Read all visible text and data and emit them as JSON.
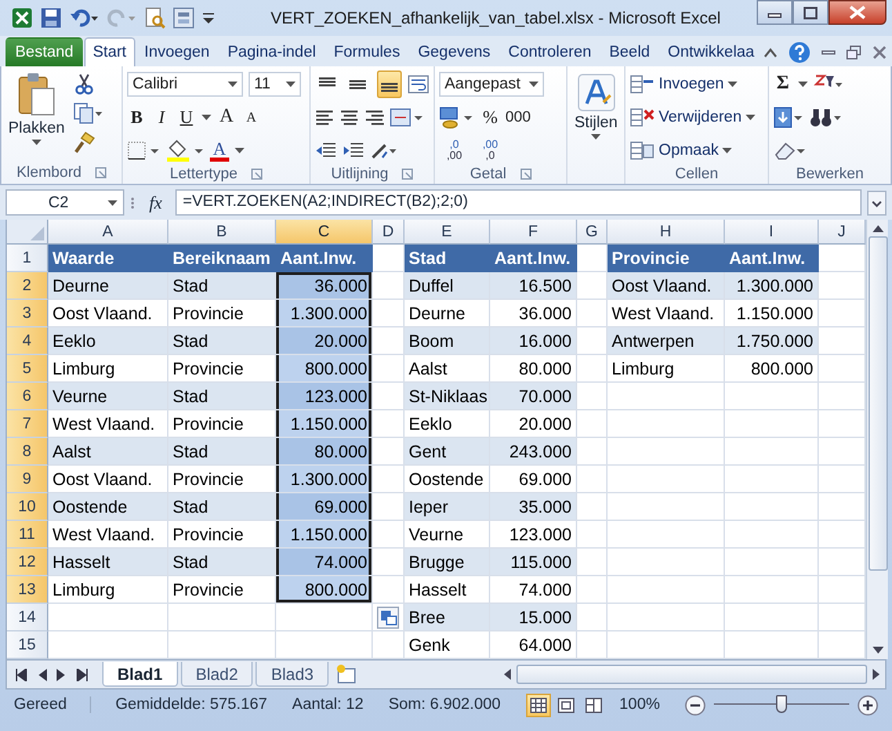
{
  "window": {
    "title": "VERT_ZOEKEN_afhankelijk_van_tabel.xlsx - Microsoft Excel"
  },
  "ribbon_tabs": [
    {
      "label": "Bestand",
      "kind": "file",
      "selected": false
    },
    {
      "label": "Start",
      "kind": "tab",
      "selected": true
    },
    {
      "label": "Invoegen",
      "kind": "tab",
      "selected": false
    },
    {
      "label": "Pagina-indel",
      "kind": "tab",
      "selected": false
    },
    {
      "label": "Formules",
      "kind": "tab",
      "selected": false
    },
    {
      "label": "Gegevens",
      "kind": "tab",
      "selected": false
    },
    {
      "label": "Controleren",
      "kind": "tab",
      "selected": false
    },
    {
      "label": "Beeld",
      "kind": "tab",
      "selected": false
    },
    {
      "label": "Ontwikkelaa",
      "kind": "tab",
      "selected": false
    }
  ],
  "ribbon": {
    "clipboard": {
      "paste": "Plakken",
      "group_label": "Klembord"
    },
    "font": {
      "name": "Calibri",
      "size": "11",
      "styles": [
        "B",
        "I",
        "U"
      ],
      "grow": "A",
      "shrink": "A",
      "color_letter": "A",
      "group_label": "Lettertype"
    },
    "alignment": {
      "vertical": [
        {
          "selected": false
        },
        {
          "selected": false
        },
        {
          "selected": true
        }
      ],
      "group_label": "Uitlijning"
    },
    "number": {
      "format": "Aangepast",
      "percent": "%",
      "thousands": "000",
      "decimals": [
        {
          "top": ",0",
          "bottom": ",00"
        },
        {
          "top": ",00",
          "bottom": ",0"
        }
      ],
      "group_label": "Getal"
    },
    "styles": {
      "label": "Stijlen"
    },
    "cells": {
      "items": [
        "Invoegen",
        "Verwijderen",
        "Opmaak"
      ],
      "group_label": "Cellen"
    },
    "editing": {
      "sum": "Σ",
      "group_label": "Bewerken"
    }
  },
  "formula_bar": {
    "name_box": "C2",
    "fx": "fx",
    "formula": "=VERT.ZOEKEN(A2;INDIRECT(B2);2;0)"
  },
  "sheet": {
    "columns": [
      {
        "label": "A",
        "selected": false
      },
      {
        "label": "B",
        "selected": false
      },
      {
        "label": "C",
        "selected": true
      },
      {
        "label": "D",
        "selected": false
      },
      {
        "label": "E",
        "selected": false
      },
      {
        "label": "F",
        "selected": false
      },
      {
        "label": "G",
        "selected": false
      },
      {
        "label": "H",
        "selected": false
      },
      {
        "label": "I",
        "selected": false
      },
      {
        "label": "J",
        "selected": false
      }
    ],
    "rows": [
      {
        "label": "1",
        "selected": false,
        "cells": [
          {
            "text": "Waarde",
            "kind": "heading",
            "selected": false
          },
          {
            "text": "Bereiknaam",
            "kind": "heading",
            "selected": false
          },
          {
            "text": "Aant.Inw.",
            "kind": "heading",
            "selected": false
          },
          null,
          {
            "text": "Stad",
            "kind": "heading",
            "selected": false
          },
          {
            "text": "Aant.Inw.",
            "kind": "heading",
            "selected": false
          },
          null,
          {
            "text": "Provincie",
            "kind": "heading",
            "selected": false
          },
          {
            "text": "Aant.Inw.",
            "kind": "heading",
            "selected": false
          },
          null
        ]
      },
      {
        "label": "2",
        "selected": true,
        "cells": [
          {
            "text": "Deurne",
            "kind": "text",
            "selected": false
          },
          {
            "text": "Stad",
            "kind": "text",
            "selected": false
          },
          {
            "text": "36.000",
            "kind": "number",
            "selected": true
          },
          null,
          {
            "text": "Duffel",
            "kind": "text",
            "selected": false
          },
          {
            "text": "16.500",
            "kind": "number",
            "selected": false
          },
          null,
          {
            "text": "Oost Vlaand.",
            "kind": "text",
            "selected": false
          },
          {
            "text": "1.300.000",
            "kind": "number",
            "selected": false
          },
          null
        ]
      },
      {
        "label": "3",
        "selected": true,
        "cells": [
          {
            "text": "Oost Vlaand.",
            "kind": "text",
            "selected": false
          },
          {
            "text": "Provincie",
            "kind": "text",
            "selected": false
          },
          {
            "text": "1.300.000",
            "kind": "number",
            "selected": true
          },
          null,
          {
            "text": "Deurne",
            "kind": "text",
            "selected": false
          },
          {
            "text": "36.000",
            "kind": "number",
            "selected": false
          },
          null,
          {
            "text": "West Vlaand.",
            "kind": "text",
            "selected": false
          },
          {
            "text": "1.150.000",
            "kind": "number",
            "selected": false
          },
          null
        ]
      },
      {
        "label": "4",
        "selected": true,
        "cells": [
          {
            "text": "Eeklo",
            "kind": "text",
            "selected": false
          },
          {
            "text": "Stad",
            "kind": "text",
            "selected": false
          },
          {
            "text": "20.000",
            "kind": "number",
            "selected": true
          },
          null,
          {
            "text": "Boom",
            "kind": "text",
            "selected": false
          },
          {
            "text": "16.000",
            "kind": "number",
            "selected": false
          },
          null,
          {
            "text": "Antwerpen",
            "kind": "text",
            "selected": false
          },
          {
            "text": "1.750.000",
            "kind": "number",
            "selected": false
          },
          null
        ]
      },
      {
        "label": "5",
        "selected": true,
        "cells": [
          {
            "text": "Limburg",
            "kind": "text",
            "selected": false
          },
          {
            "text": "Provincie",
            "kind": "text",
            "selected": false
          },
          {
            "text": "800.000",
            "kind": "number",
            "selected": true
          },
          null,
          {
            "text": "Aalst",
            "kind": "text",
            "selected": false
          },
          {
            "text": "80.000",
            "kind": "number",
            "selected": false
          },
          null,
          {
            "text": "Limburg",
            "kind": "text",
            "selected": false
          },
          {
            "text": "800.000",
            "kind": "number",
            "selected": false
          },
          null
        ]
      },
      {
        "label": "6",
        "selected": true,
        "cells": [
          {
            "text": "Veurne",
            "kind": "text",
            "selected": false
          },
          {
            "text": "Stad",
            "kind": "text",
            "selected": false
          },
          {
            "text": "123.000",
            "kind": "number",
            "selected": true
          },
          null,
          {
            "text": "St-Niklaas",
            "kind": "text",
            "selected": false
          },
          {
            "text": "70.000",
            "kind": "number",
            "selected": false
          },
          null,
          null,
          null,
          null
        ]
      },
      {
        "label": "7",
        "selected": true,
        "cells": [
          {
            "text": "West Vlaand.",
            "kind": "text",
            "selected": false
          },
          {
            "text": "Provincie",
            "kind": "text",
            "selected": false
          },
          {
            "text": "1.150.000",
            "kind": "number",
            "selected": true
          },
          null,
          {
            "text": "Eeklo",
            "kind": "text",
            "selected": false
          },
          {
            "text": "20.000",
            "kind": "number",
            "selected": false
          },
          null,
          null,
          null,
          null
        ]
      },
      {
        "label": "8",
        "selected": true,
        "cells": [
          {
            "text": "Aalst",
            "kind": "text",
            "selected": false
          },
          {
            "text": "Stad",
            "kind": "text",
            "selected": false
          },
          {
            "text": "80.000",
            "kind": "number",
            "selected": true
          },
          null,
          {
            "text": "Gent",
            "kind": "text",
            "selected": false
          },
          {
            "text": "243.000",
            "kind": "number",
            "selected": false
          },
          null,
          null,
          null,
          null
        ]
      },
      {
        "label": "9",
        "selected": true,
        "cells": [
          {
            "text": "Oost Vlaand.",
            "kind": "text",
            "selected": false
          },
          {
            "text": "Provincie",
            "kind": "text",
            "selected": false
          },
          {
            "text": "1.300.000",
            "kind": "number",
            "selected": true
          },
          null,
          {
            "text": "Oostende",
            "kind": "text",
            "selected": false
          },
          {
            "text": "69.000",
            "kind": "number",
            "selected": false
          },
          null,
          null,
          null,
          null
        ]
      },
      {
        "label": "10",
        "selected": true,
        "cells": [
          {
            "text": "Oostende",
            "kind": "text",
            "selected": false
          },
          {
            "text": "Stad",
            "kind": "text",
            "selected": false
          },
          {
            "text": "69.000",
            "kind": "number",
            "selected": true
          },
          null,
          {
            "text": "Ieper",
            "kind": "text",
            "selected": false
          },
          {
            "text": "35.000",
            "kind": "number",
            "selected": false
          },
          null,
          null,
          null,
          null
        ]
      },
      {
        "label": "11",
        "selected": true,
        "cells": [
          {
            "text": "West Vlaand.",
            "kind": "text",
            "selected": false
          },
          {
            "text": "Provincie",
            "kind": "text",
            "selected": false
          },
          {
            "text": "1.150.000",
            "kind": "number",
            "selected": true
          },
          null,
          {
            "text": "Veurne",
            "kind": "text",
            "selected": false
          },
          {
            "text": "123.000",
            "kind": "number",
            "selected": false
          },
          null,
          null,
          null,
          null
        ]
      },
      {
        "label": "12",
        "selected": true,
        "cells": [
          {
            "text": "Hasselt",
            "kind": "text",
            "selected": false
          },
          {
            "text": "Stad",
            "kind": "text",
            "selected": false
          },
          {
            "text": "74.000",
            "kind": "number",
            "selected": true
          },
          null,
          {
            "text": "Brugge",
            "kind": "text",
            "selected": false
          },
          {
            "text": "115.000",
            "kind": "number",
            "selected": false
          },
          null,
          null,
          null,
          null
        ]
      },
      {
        "label": "13",
        "selected": true,
        "cells": [
          {
            "text": "Limburg",
            "kind": "text",
            "selected": false
          },
          {
            "text": "Provincie",
            "kind": "text",
            "selected": false
          },
          {
            "text": "800.000",
            "kind": "number",
            "selected": true
          },
          null,
          {
            "text": "Hasselt",
            "kind": "text",
            "selected": false
          },
          {
            "text": "74.000",
            "kind": "number",
            "selected": false
          },
          null,
          null,
          null,
          null
        ]
      },
      {
        "label": "14",
        "selected": false,
        "cells": [
          null,
          null,
          null,
          null,
          {
            "text": "Bree",
            "kind": "text",
            "selected": false
          },
          {
            "text": "15.000",
            "kind": "number",
            "selected": false
          },
          null,
          null,
          null,
          null
        ]
      },
      {
        "label": "15",
        "selected": false,
        "cells": [
          null,
          null,
          null,
          null,
          {
            "text": "Genk",
            "kind": "text",
            "selected": false
          },
          {
            "text": "64.000",
            "kind": "number",
            "selected": false
          },
          null,
          null,
          null,
          null
        ]
      }
    ]
  },
  "sheet_tabs": [
    {
      "label": "Blad1",
      "selected": true
    },
    {
      "label": "Blad2",
      "selected": false
    },
    {
      "label": "Blad3",
      "selected": false
    }
  ],
  "status_bar": {
    "state": "Gereed",
    "average": "Gemiddelde: 575.167",
    "count": "Aantal: 12",
    "sum": "Som: 6.902.000",
    "views": [
      {
        "selected": true
      },
      {
        "selected": false
      },
      {
        "selected": false
      }
    ],
    "zoom": "100%",
    "zoom_slider": {
      "level": 0.5
    }
  }
}
